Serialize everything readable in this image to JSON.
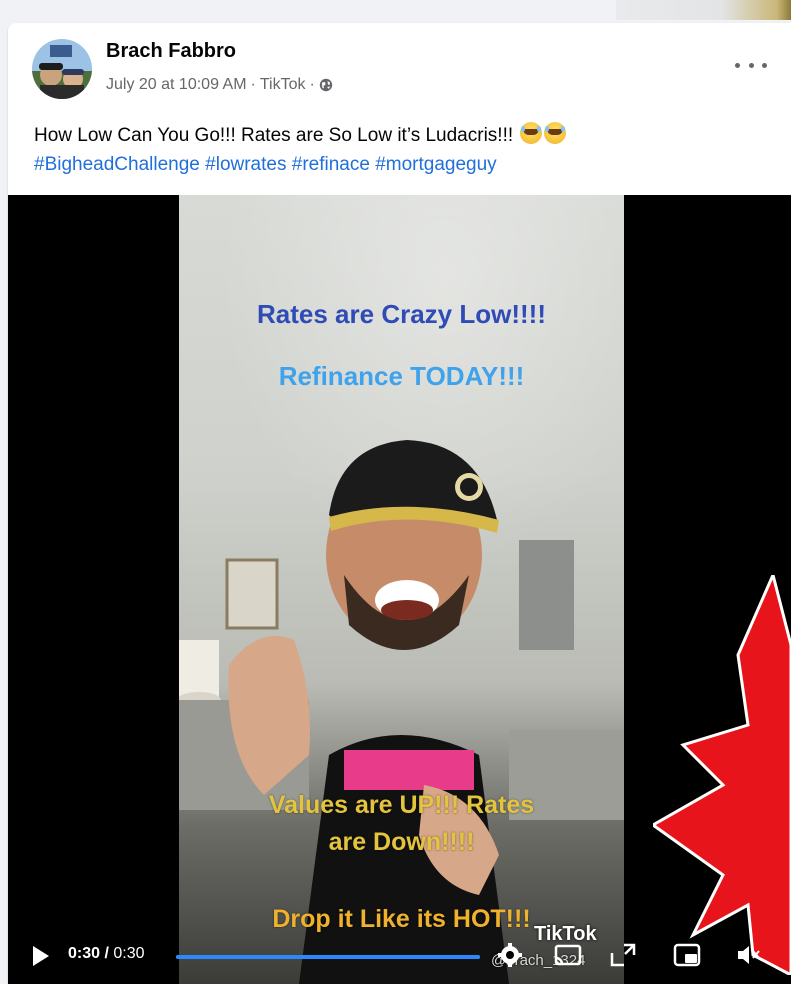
{
  "post": {
    "author": "Brach Fabbro",
    "timestamp": "July 20 at 10:09 AM",
    "source": "TikTok",
    "caption_text": "How Low Can You Go!!! Rates are So Low it’s Ludacris!!!",
    "hashtags": [
      "#BigheadChallenge",
      "#lowrates",
      "#refinace",
      "#mortgageguy"
    ]
  },
  "video": {
    "overlay_line1": "Rates are Crazy Low!!!!",
    "overlay_line2": "Refinance TODAY!!!",
    "overlay_line3a": "Values are UP!!! Rates",
    "overlay_line3b": "are Down!!!!",
    "overlay_line4": "Drop it Like its HOT!!!",
    "watermark": "TikTok",
    "watermark_user": "@brach_1324",
    "current_time": "0:30",
    "duration": "0:30",
    "progress": 1.0
  },
  "colors": {
    "link_blue": "#216fdb",
    "progress_blue": "#2d88ff",
    "starburst_red": "#e8141b"
  },
  "icons": [
    "globe-icon",
    "more-options-icon",
    "play-icon",
    "settings-icon",
    "cast-icon",
    "fullscreen-icon",
    "picture-in-picture-icon",
    "mute-icon",
    "laugh-emoji"
  ]
}
